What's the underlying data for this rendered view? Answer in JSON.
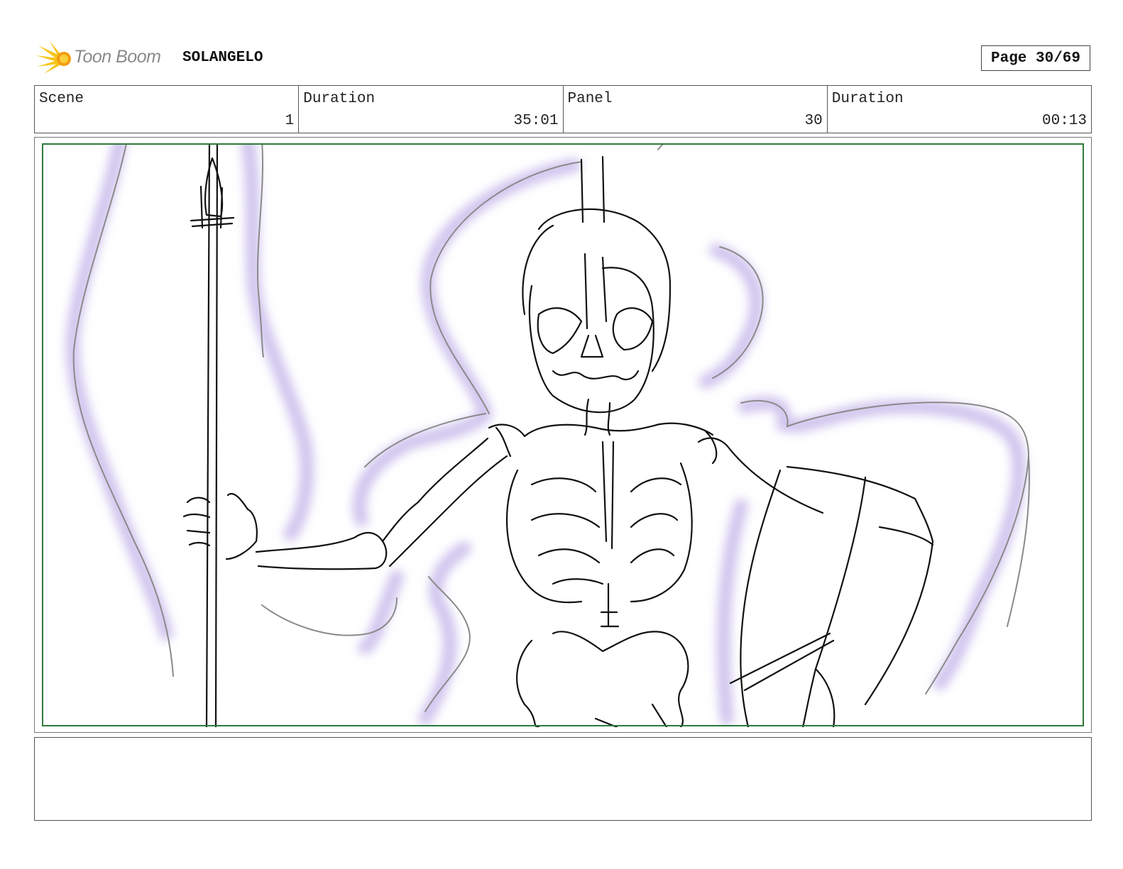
{
  "header": {
    "logo_text": "Toon Boom",
    "project_title": "SOLANGELO",
    "page_label": "Page 30/69"
  },
  "info": {
    "scene_label": "Scene",
    "scene_value": "1",
    "scene_duration_label": "Duration",
    "scene_duration_value": "35:01",
    "panel_label": "Panel",
    "panel_value": "30",
    "panel_duration_label": "Duration",
    "panel_duration_value": "00:13"
  },
  "panel": {
    "subject": "skeleton-warrior-sketch",
    "colors": {
      "safe_area": "#2f7a3a",
      "glow": "#cfc4ee",
      "ink": "#111111"
    }
  },
  "notes": {
    "text": ""
  }
}
